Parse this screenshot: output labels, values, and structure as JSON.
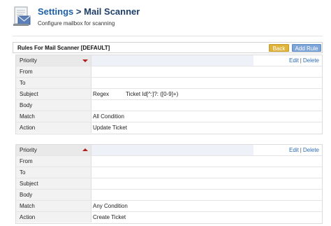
{
  "header": {
    "breadcrumb_settings": "Settings",
    "breadcrumb_sep": ">",
    "breadcrumb_current": "Mail Scanner",
    "subtitle": "Configure mailbox for scanning"
  },
  "panel": {
    "title": "Rules For Mail Scanner [DEFAULT]",
    "back_label": "Back",
    "add_rule_label": "Add Rule"
  },
  "rules": [
    {
      "priority_label": "Priority",
      "from_label": "From",
      "to_label": "To",
      "subject_label": "Subject",
      "subject_op": "Regex",
      "subject_value": "Ticket Id[^:]?: ([0-9]+)",
      "body_label": "Body",
      "match_label": "Match",
      "match_value": "All Condition",
      "action_label": "Action",
      "action_value": "Update Ticket",
      "edit_label": "Edit",
      "delete_label": "Delete",
      "arrow": "down"
    },
    {
      "priority_label": "Priority",
      "from_label": "From",
      "to_label": "To",
      "subject_label": "Subject",
      "subject_op": "",
      "subject_value": "",
      "body_label": "Body",
      "match_label": "Match",
      "match_value": "Any Condition",
      "action_label": "Action",
      "action_value": "Create Ticket",
      "edit_label": "Edit",
      "delete_label": "Delete",
      "arrow": "up"
    }
  ],
  "colors": {
    "accent": "#1d5fa8",
    "back_button": "#e0b43a",
    "add_button": "#7ea6d8",
    "arrow": "#b01e1e"
  },
  "icons": {
    "logo": "mail-scanner-icon",
    "priority_down": "arrow-down-icon",
    "priority_up": "arrow-up-icon"
  }
}
